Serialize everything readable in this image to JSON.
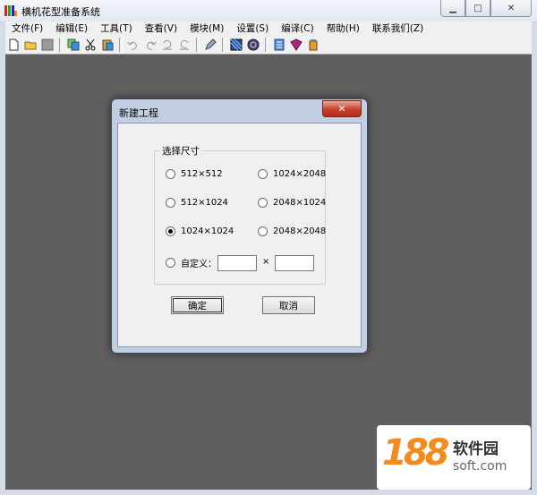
{
  "window": {
    "title": "横机花型准备系统",
    "icon": "app-multicolor-icon"
  },
  "menubar": [
    {
      "label": "文件(F)"
    },
    {
      "label": "编辑(E)"
    },
    {
      "label": "工具(T)"
    },
    {
      "label": "查看(V)"
    },
    {
      "label": "模块(M)"
    },
    {
      "label": "设置(S)"
    },
    {
      "label": "编译(C)"
    },
    {
      "label": "帮助(H)"
    },
    {
      "label": "联系我们(Z)"
    }
  ],
  "toolbar": [
    "new-file-icon",
    "open-folder-icon",
    "gray-square-icon",
    "copy-icon",
    "cut-icon",
    "paste-icon",
    "undo-icon",
    "redo-icon",
    "undo-all-icon",
    "redo-all-icon",
    "pen-icon",
    "pattern-icon",
    "knit-icon",
    "notebook-icon",
    "book-icon",
    "jar-icon"
  ],
  "dialog": {
    "title": "新建工程",
    "group_label": "选择尺寸",
    "options": [
      {
        "label": "512×512",
        "selected": false
      },
      {
        "label": "1024×2048",
        "selected": false
      },
      {
        "label": "512×1024",
        "selected": false
      },
      {
        "label": "2048×1024",
        "selected": false
      },
      {
        "label": "1024×1024",
        "selected": true
      },
      {
        "label": "2048×2048",
        "selected": false
      }
    ],
    "custom_label": "自定义：",
    "custom_width": "",
    "custom_height": "",
    "times": "×",
    "ok_label": "确定",
    "cancel_label": "取消"
  },
  "watermark": {
    "num": "188",
    "name": "软件园",
    "site": "soft.com"
  }
}
